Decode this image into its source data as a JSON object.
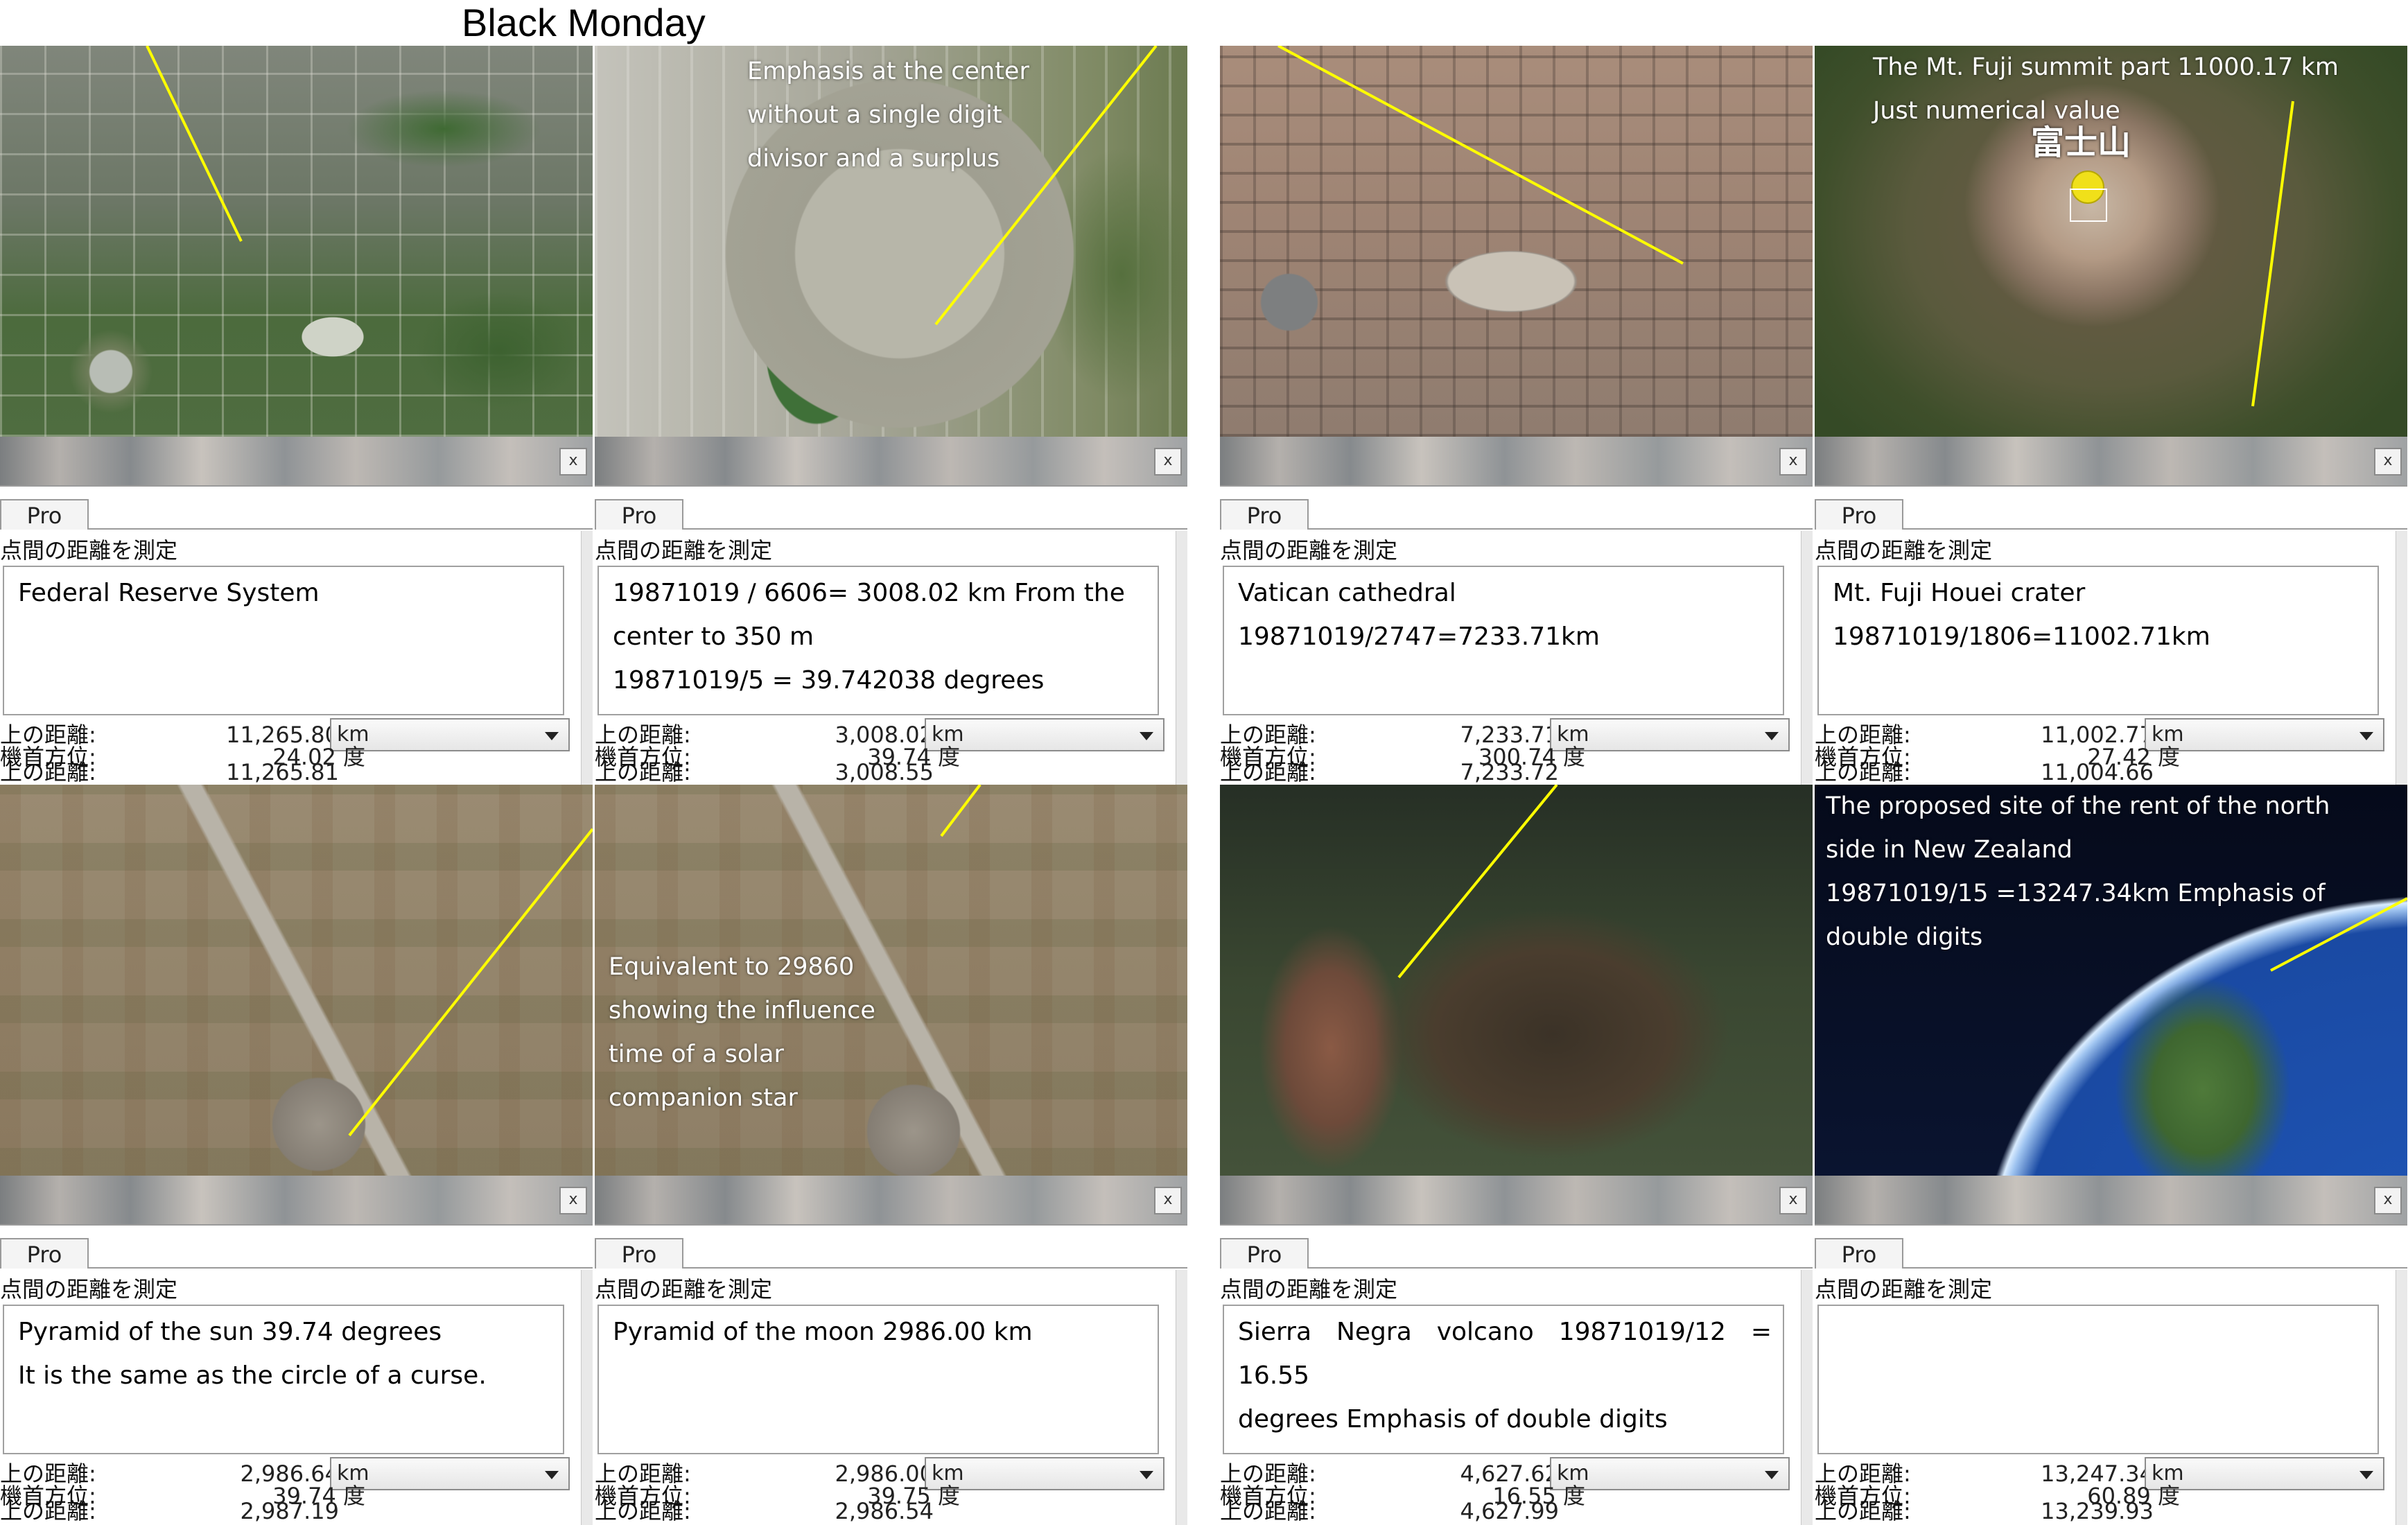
{
  "page": {
    "title": "Black Monday"
  },
  "common": {
    "tab_label": "Pro",
    "heading": "点間の距離を測定",
    "label_distance": "上の距離:",
    "label_ground": "上の距離:",
    "label_heading": "機首方位:",
    "degree_unit": "度",
    "close_symbol": "x"
  },
  "panels": [
    {
      "map_style": "city-dc",
      "overlay_lines": [],
      "notes": [
        "Federal Reserve System"
      ],
      "distance": "11,265.80",
      "unit": "km",
      "ground_distance": "11,265.81",
      "heading": "24.02"
    },
    {
      "map_style": "stadium",
      "overlay_lines": [
        "Emphasis at the center",
        "without a single digit",
        "divisor and a surplus"
      ],
      "notes": [
        "19871019 / 6606= 3008.02 km From the",
        "center to 350 m",
        "19871019/5 = 39.742038 degrees"
      ],
      "distance": "3,008.02",
      "unit": "km",
      "ground_distance": "3,008.55",
      "heading": "39.74"
    },
    {
      "map_style": "vatican",
      "overlay_lines": [],
      "notes": [
        "Vatican cathedral",
        "19871019/2747=7233.71km"
      ],
      "distance": "7,233.71",
      "unit": "km",
      "ground_distance": "7,233.72",
      "heading": "300.74"
    },
    {
      "map_style": "fuji",
      "overlay_lines": [
        "The Mt. Fuji summit part 11000.17 km",
        "Just numerical value"
      ],
      "place_label": "富士山",
      "notes": [
        "Mt. Fuji Houei crater",
        "19871019/1806=11002.71km"
      ],
      "distance": "11,002.77",
      "unit": "km",
      "ground_distance": "11,004.66",
      "heading": "27.42"
    },
    {
      "map_style": "teotihuacan-sun",
      "overlay_lines": [],
      "notes": [
        "Pyramid of the sun 39.74 degrees",
        "It is the same as the circle of a curse."
      ],
      "distance": "2,986.64",
      "unit": "km",
      "ground_distance": "2,987.19",
      "heading": "39.74"
    },
    {
      "map_style": "teotihuacan-moon",
      "overlay_lines": [
        "Equivalent to 29860",
        "showing the influence",
        "time of a solar",
        "companion star"
      ],
      "notes": [
        "Pyramid of the moon 2986.00 km"
      ],
      "distance": "2,986.00",
      "unit": "km",
      "ground_distance": "2,986.54",
      "heading": "39.75"
    },
    {
      "map_style": "volcano",
      "overlay_lines": [],
      "notes": [
        "Sierra Negra volcano 19871019/12 = 16.55",
        "degrees Emphasis of double digits"
      ],
      "distance": "4,627.62",
      "unit": "km",
      "ground_distance": "4,627.99",
      "heading": "16.55"
    },
    {
      "map_style": "globe",
      "overlay_lines": [
        "The proposed site of the rent of the north",
        "side in New Zealand",
        "19871019/15 =13247.34km Emphasis of",
        "double digits"
      ],
      "notes": [],
      "distance": "13,247.34",
      "unit": "km",
      "ground_distance": "13,239.93",
      "heading": "60.89"
    }
  ]
}
